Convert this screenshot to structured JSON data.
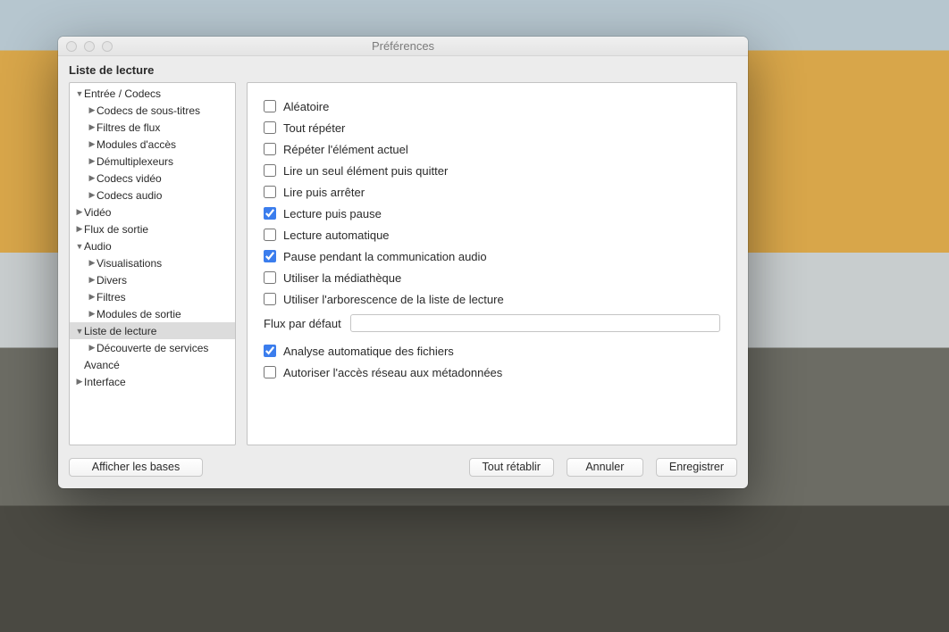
{
  "window": {
    "title": "Préférences",
    "section": "Liste de lecture"
  },
  "sidebar": {
    "items": [
      {
        "label": "Entrée / Codecs",
        "depth": 0,
        "disclosure": "down",
        "selected": false
      },
      {
        "label": "Codecs de sous-titres",
        "depth": 1,
        "disclosure": "right",
        "selected": false
      },
      {
        "label": "Filtres de flux",
        "depth": 1,
        "disclosure": "right",
        "selected": false
      },
      {
        "label": "Modules d'accès",
        "depth": 1,
        "disclosure": "right",
        "selected": false
      },
      {
        "label": "Démultiplexeurs",
        "depth": 1,
        "disclosure": "right",
        "selected": false
      },
      {
        "label": "Codecs vidéo",
        "depth": 1,
        "disclosure": "right",
        "selected": false
      },
      {
        "label": "Codecs audio",
        "depth": 1,
        "disclosure": "right",
        "selected": false
      },
      {
        "label": "Vidéo",
        "depth": 0,
        "disclosure": "right",
        "selected": false
      },
      {
        "label": "Flux de sortie",
        "depth": 0,
        "disclosure": "right",
        "selected": false
      },
      {
        "label": "Audio",
        "depth": 0,
        "disclosure": "down",
        "selected": false
      },
      {
        "label": "Visualisations",
        "depth": 1,
        "disclosure": "right",
        "selected": false
      },
      {
        "label": "Divers",
        "depth": 1,
        "disclosure": "right",
        "selected": false
      },
      {
        "label": "Filtres",
        "depth": 1,
        "disclosure": "right",
        "selected": false
      },
      {
        "label": "Modules de sortie",
        "depth": 1,
        "disclosure": "right",
        "selected": false
      },
      {
        "label": "Liste de lecture",
        "depth": 0,
        "disclosure": "down",
        "selected": true
      },
      {
        "label": "Découverte de services",
        "depth": 1,
        "disclosure": "right",
        "selected": false
      },
      {
        "label": "Avancé",
        "depth": 0,
        "disclosure": "none",
        "selected": false
      },
      {
        "label": "Interface",
        "depth": 0,
        "disclosure": "right",
        "selected": false
      }
    ]
  },
  "options": {
    "group1": [
      {
        "label": "Aléatoire",
        "checked": false
      },
      {
        "label": "Tout répéter",
        "checked": false
      },
      {
        "label": "Répéter l'élément actuel",
        "checked": false
      },
      {
        "label": "Lire un seul élément puis quitter",
        "checked": false
      },
      {
        "label": "Lire puis arrêter",
        "checked": false
      },
      {
        "label": "Lecture puis pause",
        "checked": true
      },
      {
        "label": "Lecture automatique",
        "checked": false
      },
      {
        "label": "Pause pendant la communication audio",
        "checked": true
      },
      {
        "label": "Utiliser la médiathèque",
        "checked": false
      },
      {
        "label": "Utiliser l'arborescence de la liste de lecture",
        "checked": false
      }
    ],
    "default_stream": {
      "label": "Flux par défaut",
      "value": ""
    },
    "group2": [
      {
        "label": "Analyse automatique des fichiers",
        "checked": true
      },
      {
        "label": "Autoriser l'accès réseau aux métadonnées",
        "checked": false
      }
    ]
  },
  "buttons": {
    "show_basic": "Afficher les bases",
    "reset_all": "Tout rétablir",
    "cancel": "Annuler",
    "save": "Enregistrer"
  }
}
